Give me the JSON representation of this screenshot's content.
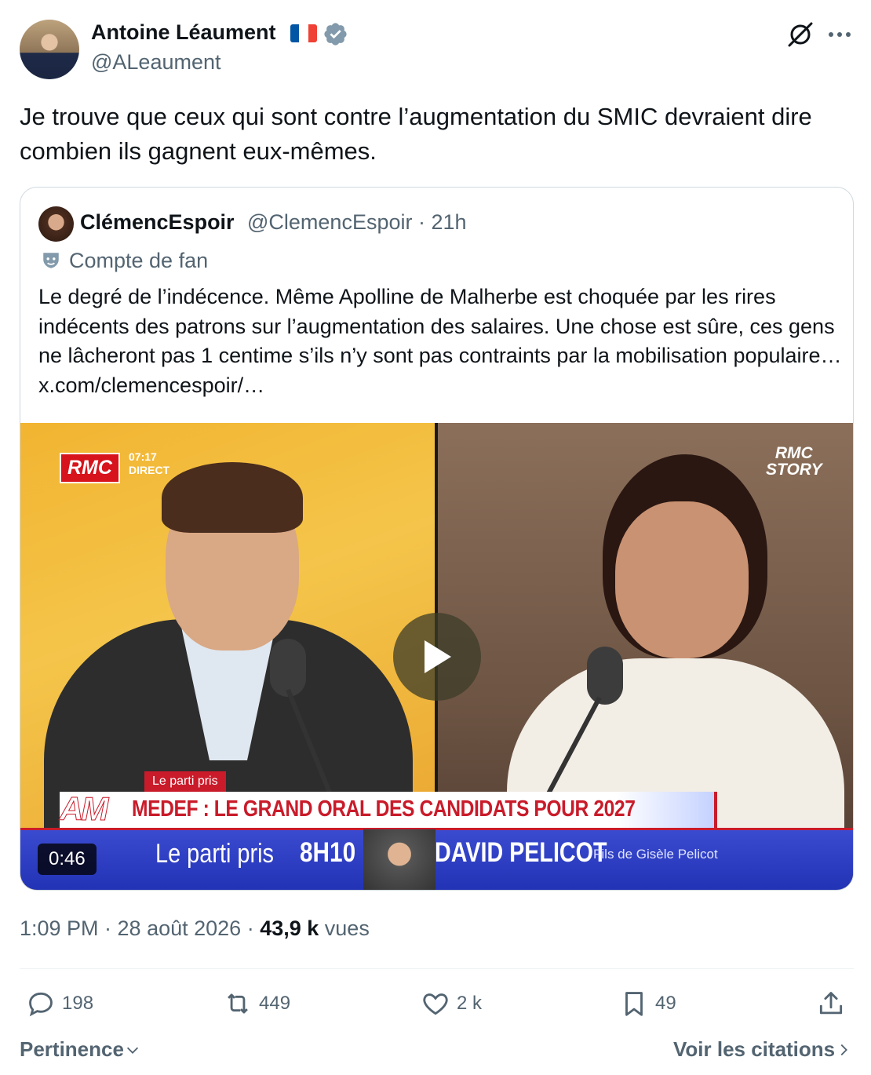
{
  "author": {
    "name": "Antoine Léaument",
    "handle": "@ALeaument",
    "flag_colors": [
      "#0055a4",
      "#ffffff",
      "#ef4135"
    ]
  },
  "tweet": {
    "text": "Je trouve que ceux qui sont contre l’augmentation du SMIC devraient dire combien ils gagnent eux-mêmes."
  },
  "quoted": {
    "name": "ClémencEspoir",
    "handle_time": "@ClemencEspoir · 21h",
    "label": "Compte de fan",
    "text": "Le degré de l’indécence. Même Apolline de Malherbe est choquée par les rires indécents des patrons sur l’augmentation des salaires. Une chose est sûre, ces gens ne lâcheront pas 1 centime s’ils n’y sont pas contraints par la mobilisation populaire…  x.com/clemencespoir/…",
    "video": {
      "duration": "0:46",
      "channel_logo": "RMC",
      "time_overlay_1": "07:17",
      "time_overlay_2": "DIRECT",
      "story_logo_1": "RMC",
      "story_logo_2": "STORY",
      "tag": "Le parti pris",
      "banner_logo": "AM",
      "banner_text": "MEDEF : LE GRAND ORAL DES CANDIDATS POUR 2027",
      "ticker_1": "Le parti pris",
      "ticker_2": "8H10",
      "ticker_3": "DAVID PELICOT",
      "ticker_4": "Fils de Gisèle Pelicot"
    }
  },
  "meta": {
    "time": "1:09 PM · 28 août 2026 · ",
    "views_count": "43,9 k",
    "views_label": " vues"
  },
  "actions": {
    "replies": "198",
    "reposts": "449",
    "likes": "2 k",
    "bookmarks": "49"
  },
  "footer": {
    "sort_label": "Pertinence",
    "quotes_link": "Voir les citations"
  },
  "colors": {
    "text_primary": "#0f1419",
    "text_secondary": "#536471",
    "verified_badge": "#829aab",
    "border": "#cfd9de"
  }
}
